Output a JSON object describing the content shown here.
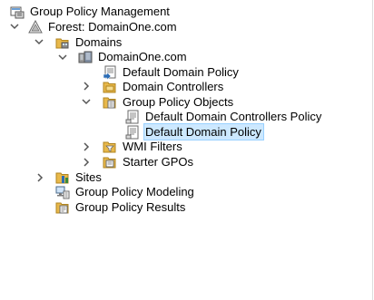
{
  "tree": {
    "root": {
      "label": "Group Policy Management",
      "icon": "gpmc-console-icon"
    },
    "forest": {
      "label": "Forest: DomainOne.com",
      "icon": "forest-icon",
      "expanded": true
    },
    "domains": {
      "label": "Domains",
      "icon": "domains-folder-icon",
      "expanded": true
    },
    "domain": {
      "label": "DomainOne.com",
      "icon": "domain-icon",
      "expanded": true
    },
    "default_domain_policy_link": {
      "label": "Default Domain Policy",
      "icon": "gpo-link-icon"
    },
    "domain_controllers": {
      "label": "Domain Controllers",
      "icon": "ou-folder-icon",
      "expanded": false
    },
    "gpo_container": {
      "label": "Group Policy Objects",
      "icon": "gpo-folder-icon",
      "expanded": true
    },
    "gpo_dc_policy": {
      "label": "Default Domain Controllers Policy",
      "icon": "gpo-icon"
    },
    "gpo_domain_policy": {
      "label": "Default Domain Policy",
      "icon": "gpo-icon",
      "selected": true
    },
    "wmi_filters": {
      "label": "WMI Filters",
      "icon": "wmi-folder-icon",
      "expanded": false
    },
    "starter_gpos": {
      "label": "Starter GPOs",
      "icon": "starter-gpo-folder-icon",
      "expanded": false
    },
    "sites": {
      "label": "Sites",
      "icon": "sites-icon",
      "expanded": false
    },
    "modeling": {
      "label": "Group Policy Modeling",
      "icon": "modeling-icon"
    },
    "results": {
      "label": "Group Policy Results",
      "icon": "results-icon"
    }
  },
  "colors": {
    "selection_background": "#cce8ff",
    "selection_border": "#99d1ff",
    "folder": "#e8b84a",
    "glyph": "#555555"
  }
}
